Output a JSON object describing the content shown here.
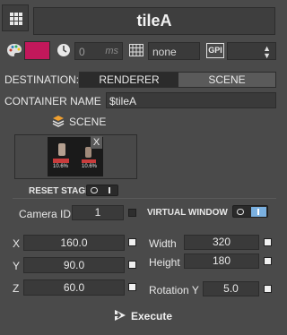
{
  "header": {
    "menu_icon": "grid-menu-icon",
    "title": "tileA"
  },
  "toolbar": {
    "color_swatch": "#c2185b",
    "delay_value": "0",
    "delay_unit": "ms",
    "mode_value": "none",
    "gpi_label": "GPI",
    "gpi_select_value": ""
  },
  "destination": {
    "label": "DESTINATION:",
    "options": [
      "RENDERER",
      "SCENE"
    ],
    "selected": "RENDERER"
  },
  "container": {
    "label": "CONTAINER NAME",
    "value": "$tileA"
  },
  "scene": {
    "label": "SCENE",
    "thumb_text_left": "10.6%",
    "thumb_text_right": "10.6%",
    "close_label": "X"
  },
  "reset_stage": {
    "label": "RESET STAGE",
    "toggle_state": "off"
  },
  "camera": {
    "label": "Camera ID",
    "value": "1"
  },
  "virtual_window": {
    "label": "VIRTUAL WINDOW",
    "toggle_state": "on"
  },
  "position": {
    "x_label": "X",
    "x_value": "160.0",
    "y_label": "Y",
    "y_value": "90.0",
    "z_label": "Z",
    "z_value": "60.0"
  },
  "size": {
    "width_label": "Width",
    "width_value": "320",
    "height_label": "Height",
    "height_value": "180"
  },
  "rotation": {
    "label": "Rotation Y",
    "value": "5.0"
  },
  "execute": {
    "label": "Execute"
  },
  "colors": {
    "background": "#4a4a4a",
    "field": "#3a3a3a",
    "accent_blue": "#7ab0e0",
    "swatch": "#c2185b"
  }
}
